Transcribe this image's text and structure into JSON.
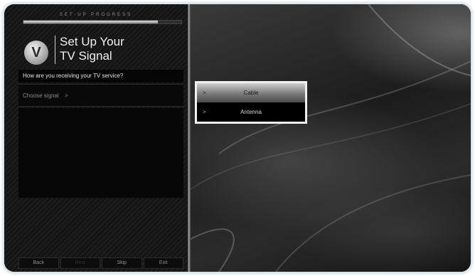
{
  "setup": {
    "progress_label": "SET-UP PROGRESS",
    "progress_value": 0.85,
    "logo_letter": "V",
    "title_line1": "Set Up Your",
    "title_line2": "TV Signal",
    "question": "How are you receiving your TV service?",
    "choose_label": "Choose signal",
    "choose_arrow": ">"
  },
  "options": [
    {
      "label": "Cable",
      "arrow": ">",
      "selected": true
    },
    {
      "label": "Antenna",
      "arrow": ">",
      "selected": false
    }
  ],
  "footer": {
    "back": "Back",
    "next": "Next",
    "skip": "Skip",
    "exit": "Exit"
  }
}
